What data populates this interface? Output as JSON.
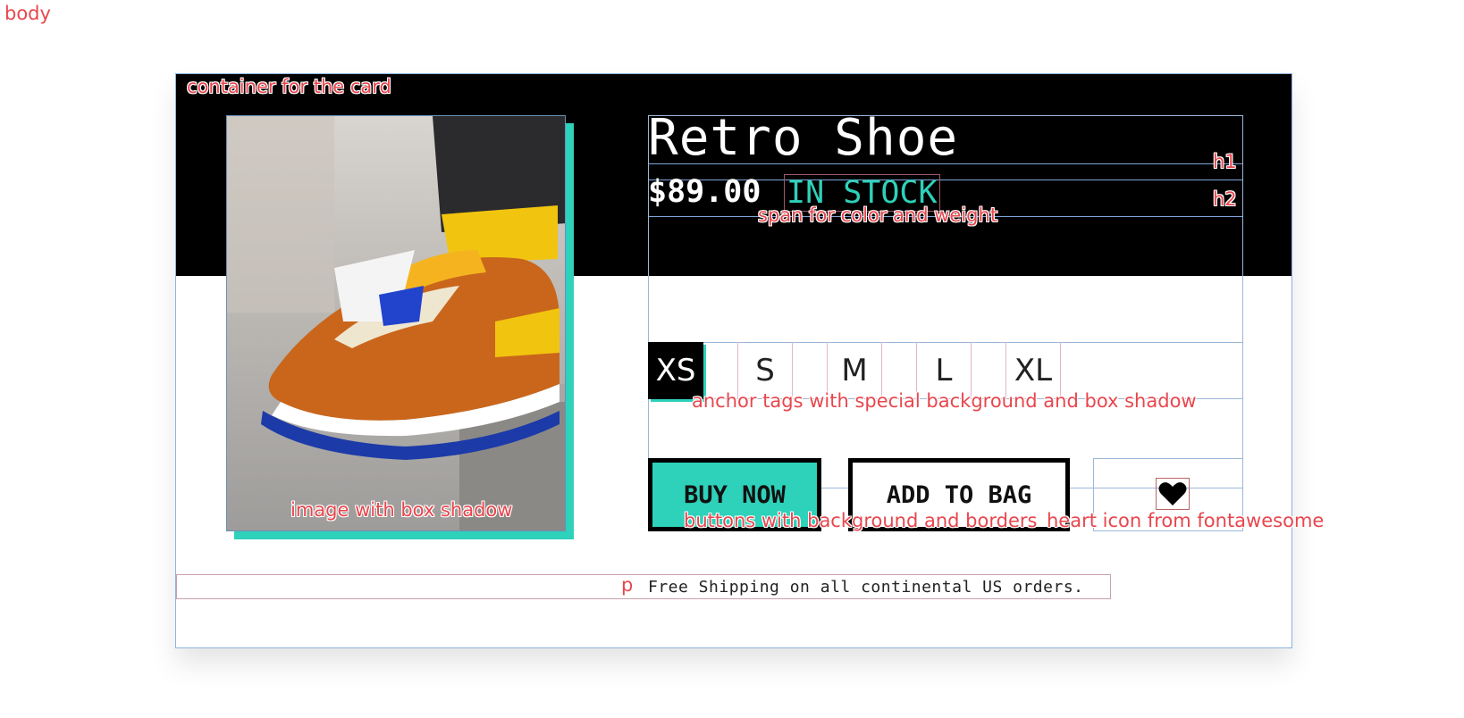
{
  "annotations": {
    "body": "body",
    "container": "container for the card",
    "h1": "h1",
    "h2": "h2",
    "span": "span for color and weight",
    "image": "image with box shadow",
    "anchors": "anchor tags with special background and box shadow",
    "buttons": "buttons with background and borders",
    "heart": "heart icon from fontawesome",
    "p": "p"
  },
  "product": {
    "title": "Retro Shoe",
    "price": "$89.00",
    "stock": "IN STOCK"
  },
  "sizes": [
    "XS",
    "S",
    "M",
    "L",
    "XL"
  ],
  "selected_size": "XS",
  "buttons": {
    "buy": "BUY NOW",
    "bag": "ADD TO BAG"
  },
  "shipping_text": "Free Shipping on all continental US orders.",
  "colors": {
    "accent": "#2ed1b9",
    "dark": "#000000",
    "annotation": "#e8464d"
  },
  "icons": {
    "heart": "heart-icon"
  }
}
